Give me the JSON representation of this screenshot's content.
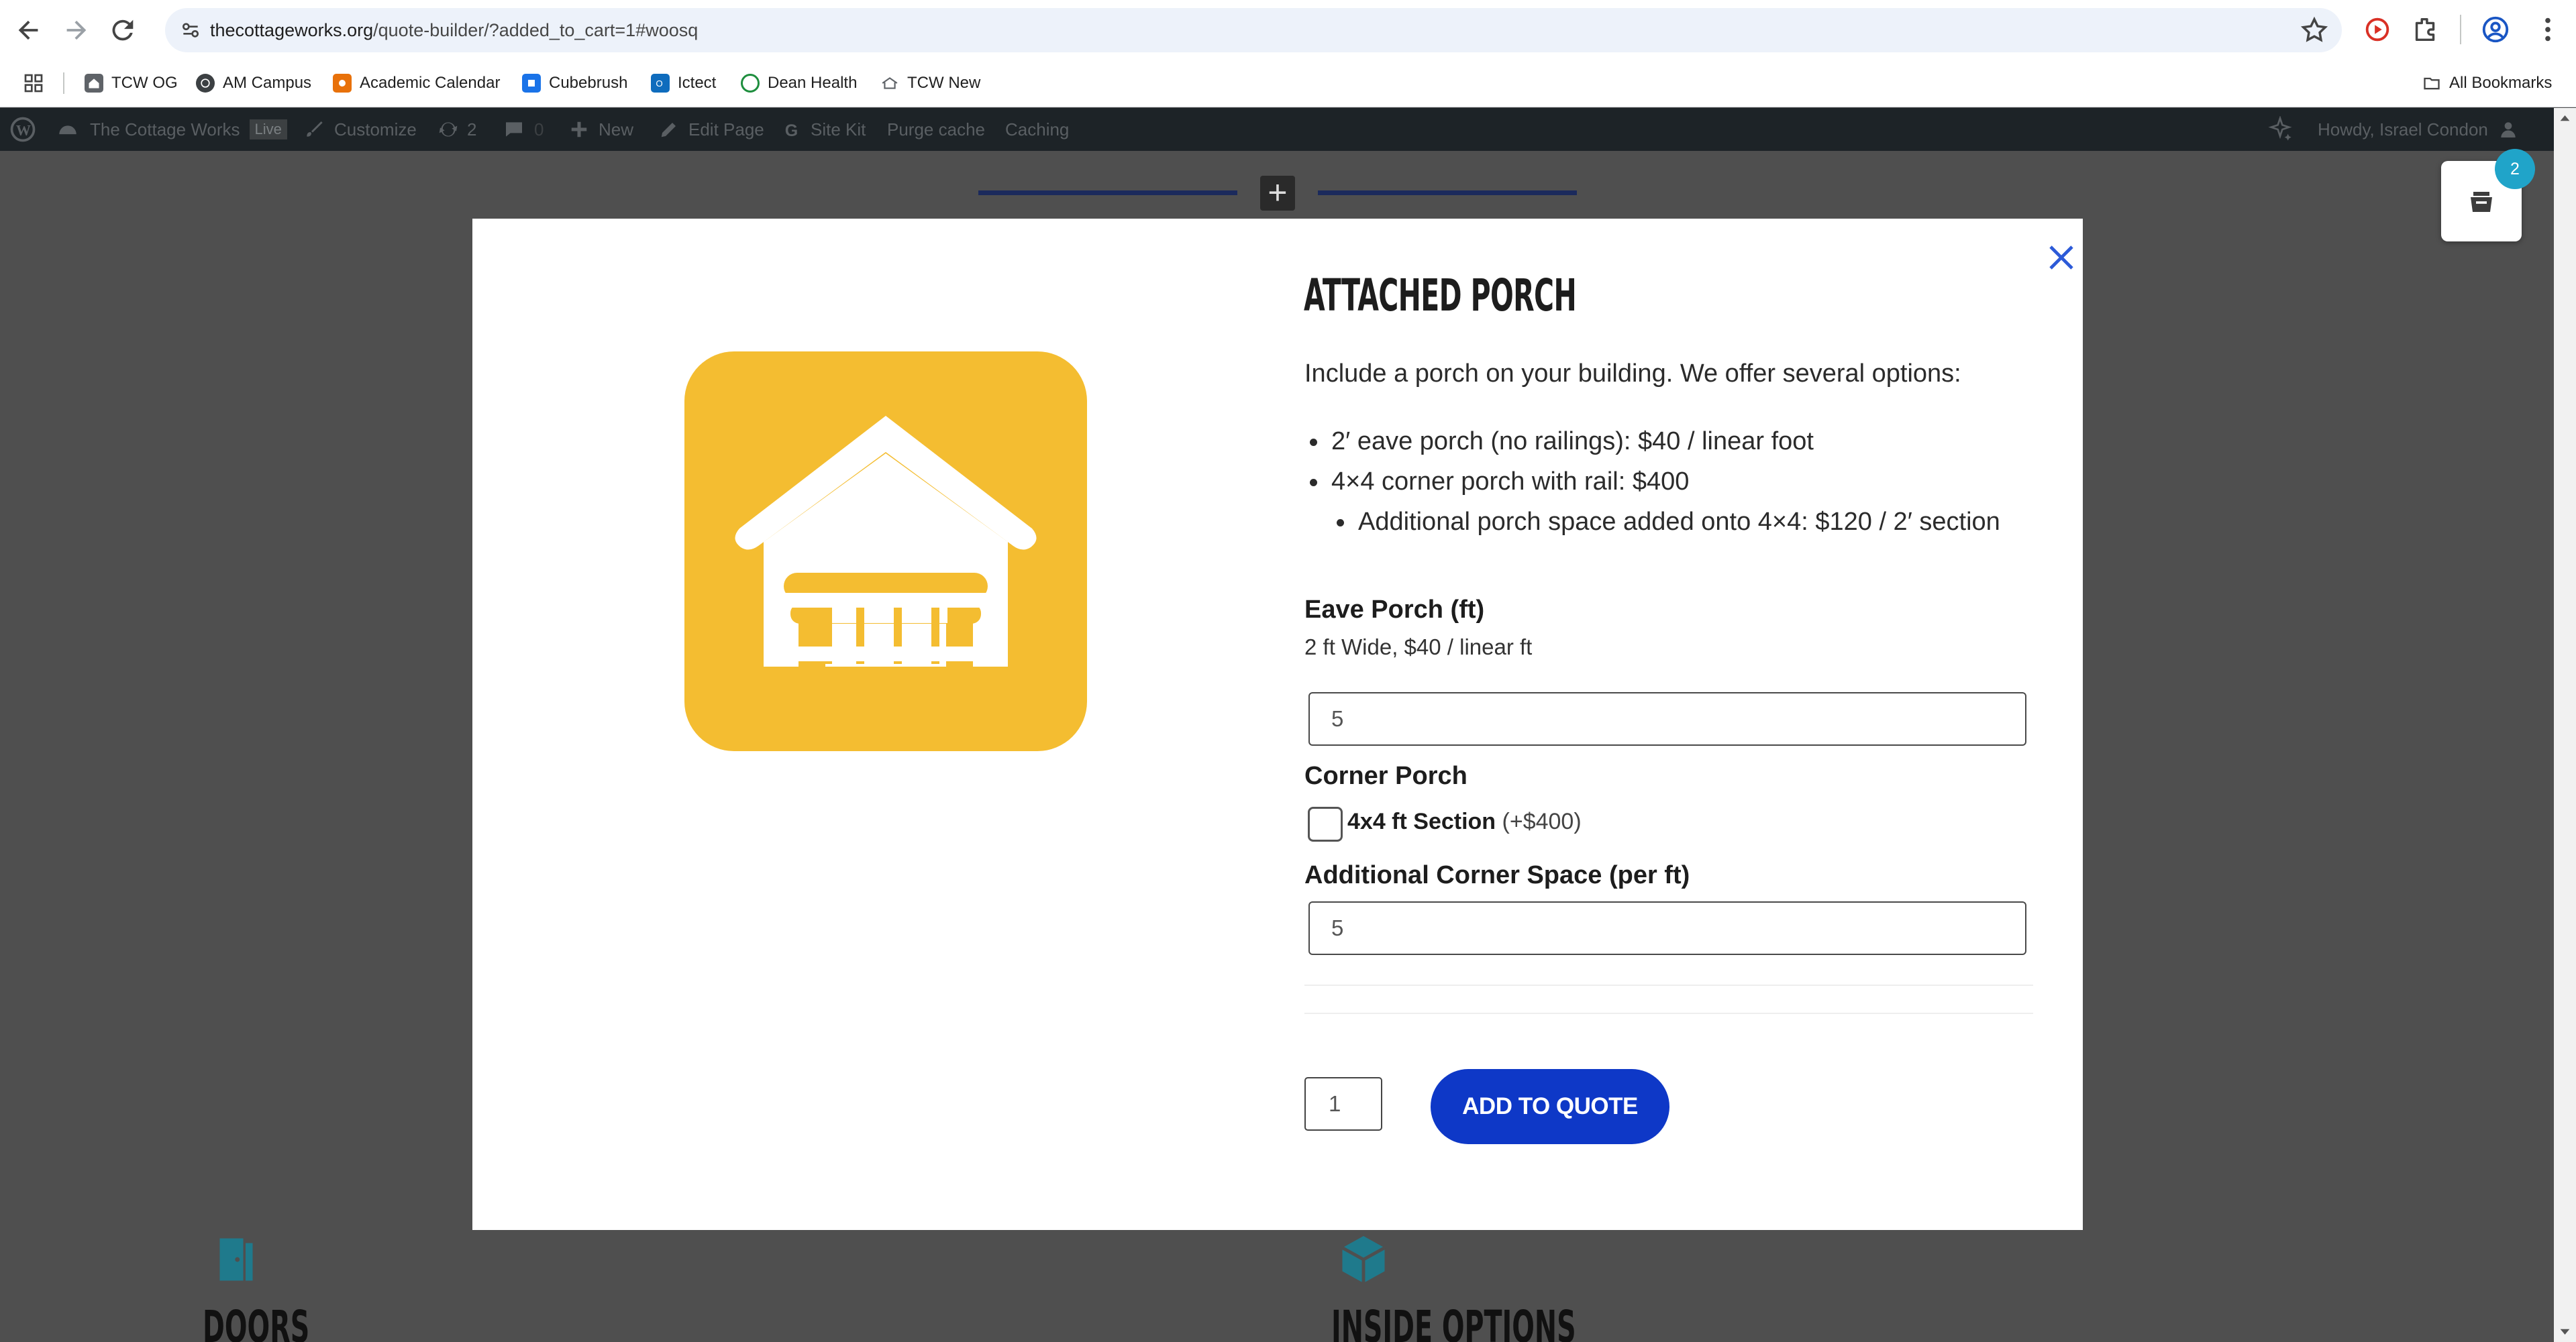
{
  "browser": {
    "url_domain": "thecottageworks.org",
    "url_path": "/quote-builder/?added_to_cart=1#woosq",
    "icons": [
      "back-icon",
      "forward-icon",
      "reload-icon",
      "site-info-icon",
      "star-icon",
      "record-icon",
      "extensions-icon",
      "profile-icon"
    ]
  },
  "bookmarks": {
    "items": [
      {
        "label": "TCW OG",
        "color": "#3c4043"
      },
      {
        "label": "AM Campus",
        "color": "#3c4043"
      },
      {
        "label": "Academic Calendar",
        "color": "#e8710a"
      },
      {
        "label": "Cubebrush",
        "color": "#1a73e8"
      },
      {
        "label": "Ictect",
        "color": "#0f6cbd"
      },
      {
        "label": "Dean Health",
        "color": "#1e8e3e"
      },
      {
        "label": "TCW New",
        "color": "#5f6368"
      }
    ],
    "all_label": "All Bookmarks"
  },
  "admin_bar": {
    "site_name": "The Cottage Works",
    "live_badge": "Live",
    "customize": "Customize",
    "updates_count": "2",
    "comments_count": "0",
    "new": "New",
    "edit_page": "Edit Page",
    "site_kit": "Site Kit",
    "purge_cache": "Purge cache",
    "caching": "Caching",
    "howdy": "Howdy, Israel Condon"
  },
  "cart": {
    "count": "2"
  },
  "modal": {
    "title": "ATTACHED PORCH",
    "intro": "Include a porch on your building. We offer several options:",
    "bullets": [
      "2′ eave porch (no railings): $40 / linear foot",
      "4×4 corner porch with rail: $400"
    ],
    "sub_bullet": "Additional porch space added onto 4×4: $120 / 2′ section",
    "eave_label": "Eave Porch (ft)",
    "eave_desc": "2 ft Wide, $40 / linear ft",
    "eave_value": "5",
    "corner_label": "Corner Porch",
    "corner_checked": false,
    "corner_option": "4x4 ft Section",
    "corner_price": "(+$400)",
    "additional_label": "Additional Corner Space (per ft)",
    "additional_value": "5",
    "quantity": "1",
    "add_button": "ADD TO QUOTE",
    "brand_color": "#0e38c7",
    "image_bg": "#f4bd31"
  },
  "sections": {
    "left": "DOORS",
    "right": "INSIDE OPTIONS",
    "icon_color": "#1f7a8c"
  }
}
